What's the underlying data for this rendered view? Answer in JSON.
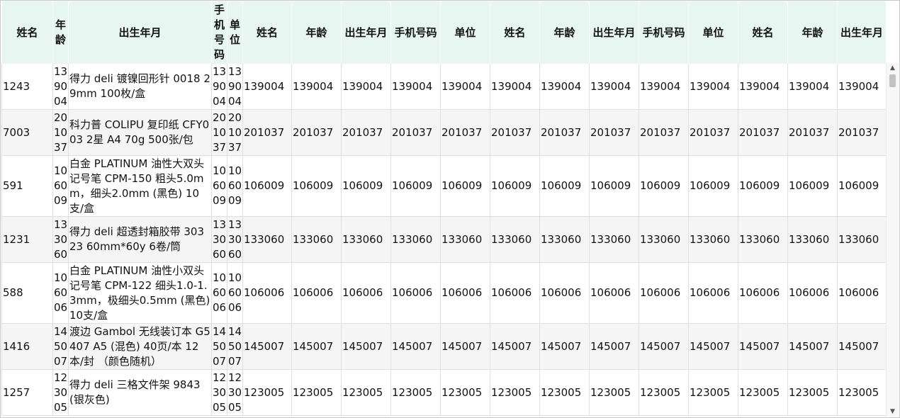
{
  "table": {
    "columns": [
      "姓名",
      "年龄",
      "出生年月",
      "手机号码",
      "单位",
      "姓名",
      "年龄",
      "出生年月",
      "手机号码",
      "单位",
      "姓名",
      "年龄",
      "出生年月",
      "手机号码",
      "单位",
      "姓名",
      "年龄",
      "出生年月"
    ],
    "rows": [
      {
        "id": "1243",
        "code": "139004",
        "desc": "得力 deli 镀镍回形针 0018 29mm 100枚/盒"
      },
      {
        "id": "7003",
        "code": "201037",
        "desc": "科力普 COLIPU 复印纸 CFY003 2星 A4 70g 500张/包"
      },
      {
        "id": "591",
        "code": "106009",
        "desc": "白金 PLATINUM 油性大双头记号笔 CPM-150 粗头5.0mm，细头2.0mm (黑色) 10支/盒"
      },
      {
        "id": "1231",
        "code": "133060",
        "desc": "得力 deli 超透封箱胶带 30323 60mm*60y 6卷/筒"
      },
      {
        "id": "588",
        "code": "106006",
        "desc": "白金 PLATINUM 油性小双头记号笔 CPM-122 细头1.0-1.3mm，极细头0.5mm (黑色) 10支/盒"
      },
      {
        "id": "1416",
        "code": "145007",
        "desc": "渡边 Gambol 无线装订本 G5407 A5 (混色) 40页/本 12本/封 （颜色随机）"
      },
      {
        "id": "1257",
        "code": "123005",
        "desc": "得力 deli 三格文件架 9843 (银灰色)"
      }
    ]
  },
  "scrollbar": {
    "up_icon": "triangle-up-icon",
    "down_icon": "triangle-down-icon"
  }
}
